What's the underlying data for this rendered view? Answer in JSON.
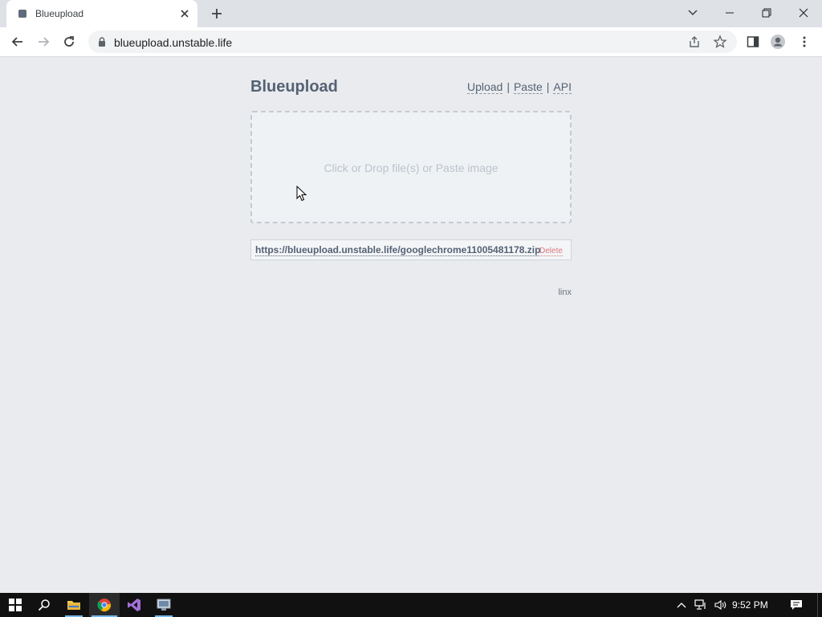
{
  "browser": {
    "tab": {
      "title": "Blueupload"
    },
    "address_bar": {
      "url": "blueupload.unstable.life"
    }
  },
  "page": {
    "site_title": "Blueupload",
    "nav": {
      "upload": "Upload",
      "paste": "Paste",
      "api": "API",
      "separator": "|"
    },
    "dropzone": {
      "text": "Click or Drop file(s) or Paste image"
    },
    "uploaded_file": {
      "link": "https://blueupload.unstable.life/googlechrome11005481178.zip",
      "delete_label": "Delete"
    },
    "footer": {
      "label": "linx"
    }
  },
  "taskbar": {
    "clock": "9:52 PM",
    "apps": [
      "start-icon",
      "search-icon",
      "file-explorer-icon",
      "chrome-icon",
      "visual-studio-icon",
      "remote-desktop-icon"
    ]
  },
  "colors": {
    "page_bg": "#e9ebee",
    "brand_text": "#556274",
    "delete_red": "#d97a7f",
    "taskbar_bg": "#111111"
  }
}
